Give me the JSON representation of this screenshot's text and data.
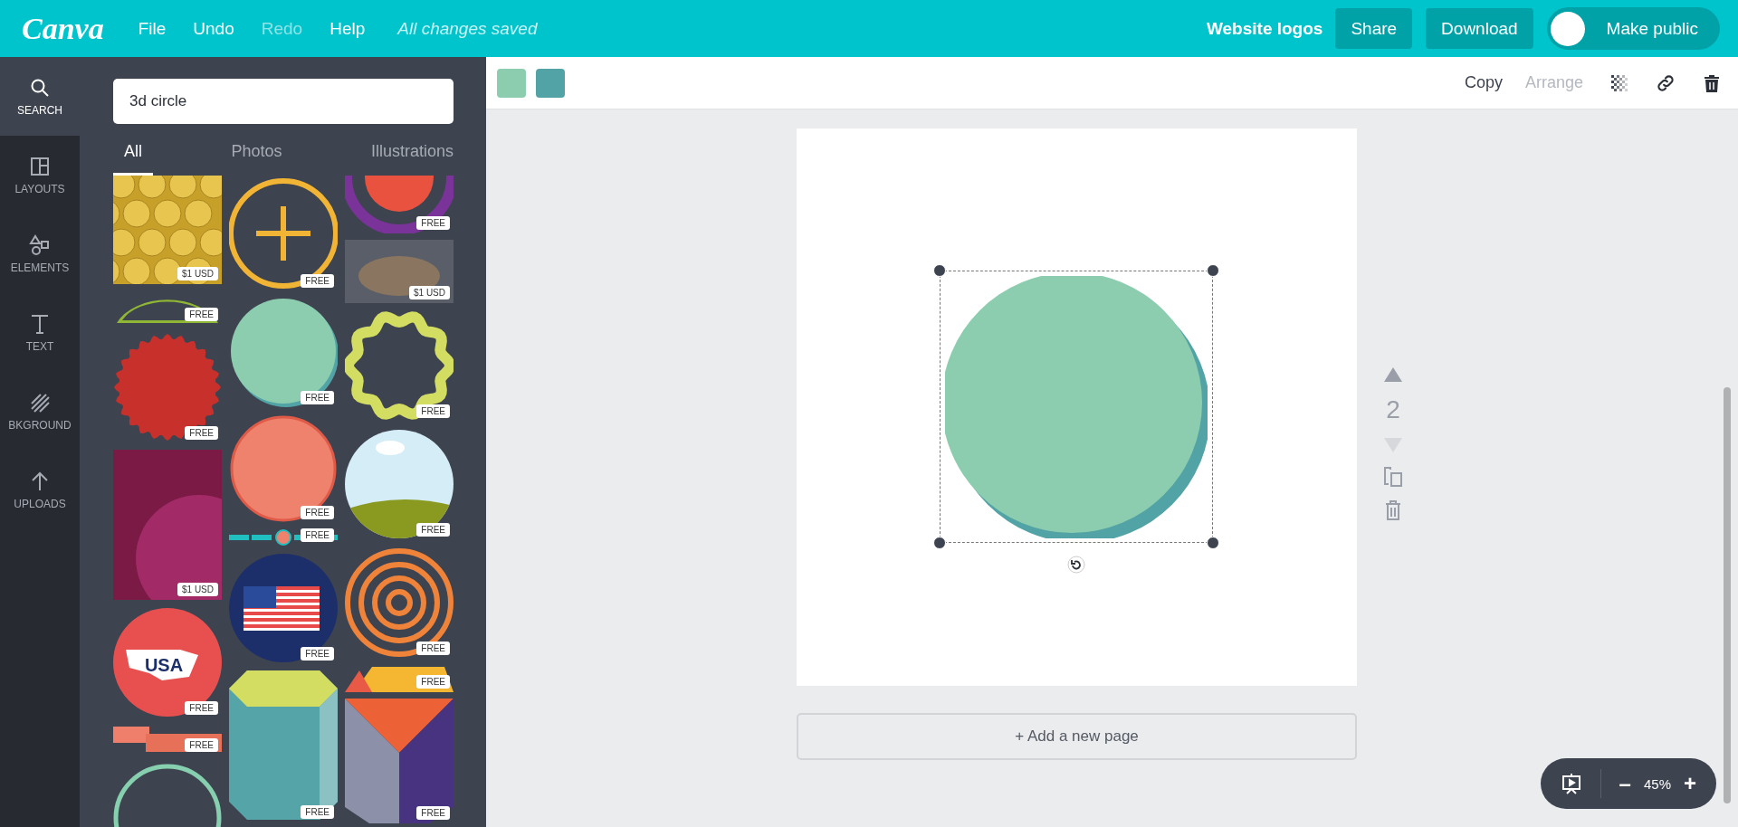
{
  "top_bar": {
    "logo": "Canva",
    "menu": [
      {
        "label": "File",
        "disabled": false
      },
      {
        "label": "Undo",
        "disabled": false
      },
      {
        "label": "Redo",
        "disabled": true
      },
      {
        "label": "Help",
        "disabled": false
      }
    ],
    "status": "All changes saved",
    "design_title": "Website logos",
    "share": "Share",
    "download": "Download",
    "make_public": {
      "label": "Make public",
      "on": false
    }
  },
  "sidebar": {
    "items": [
      {
        "kind": "search",
        "label": "SEARCH",
        "selected": true
      },
      {
        "kind": "layouts",
        "label": "LAYOUTS",
        "selected": false
      },
      {
        "kind": "elements",
        "label": "ELEMENTS",
        "selected": false
      },
      {
        "kind": "text",
        "label": "TEXT",
        "selected": false
      },
      {
        "kind": "background",
        "label": "BKGROUND",
        "selected": false
      },
      {
        "kind": "uploads",
        "label": "UPLOADS",
        "selected": false
      }
    ]
  },
  "panel": {
    "search": {
      "value": "3d circle"
    },
    "tabs": [
      {
        "label": "All",
        "selected": true
      },
      {
        "label": "Photos",
        "selected": false
      },
      {
        "label": "Illustrations",
        "selected": false
      }
    ],
    "columns": [
      [
        {
          "kind": "gold-spheres",
          "badge": "$1 USD"
        },
        {
          "kind": "arc",
          "badge": "FREE"
        },
        {
          "kind": "scallop",
          "badge": "FREE"
        },
        {
          "kind": "pink-photo",
          "badge": "$1 USD"
        },
        {
          "kind": "usa",
          "badge": "FREE",
          "caption": "USA"
        },
        {
          "kind": "ribbon",
          "badge": "FREE"
        },
        {
          "kind": "green-ring"
        }
      ],
      [
        {
          "kind": "plus-circle",
          "badge": "FREE"
        },
        {
          "kind": "teal-circle",
          "badge": "FREE"
        },
        {
          "kind": "salmon-circle",
          "badge": "FREE"
        },
        {
          "kind": "button-strip",
          "badge": "FREE"
        },
        {
          "kind": "flag-circle",
          "badge": "FREE"
        },
        {
          "kind": "hexagon",
          "badge": "FREE"
        }
      ],
      [
        {
          "kind": "target",
          "badge": "FREE"
        },
        {
          "kind": "dino-photo",
          "badge": "$1 USD"
        },
        {
          "kind": "wavy-ring",
          "badge": "FREE"
        },
        {
          "kind": "sky-circle",
          "badge": "FREE"
        },
        {
          "kind": "rings",
          "badge": "FREE"
        },
        {
          "kind": "tri-banner",
          "badge": "FREE"
        },
        {
          "kind": "prism",
          "badge": "FREE"
        }
      ]
    ]
  },
  "toolbar": {
    "colors": [
      {
        "color": "#8ccdb0"
      },
      {
        "color": "#52a3a5"
      }
    ],
    "copy": {
      "label": "Copy",
      "disabled": false
    },
    "arrange": {
      "label": "Arrange",
      "disabled": true
    }
  },
  "page_controls": {
    "page_number": "2",
    "up_disabled": false,
    "down_disabled": true
  },
  "add_page": "+ Add a new page",
  "zoom": {
    "value": "45%",
    "minus": "–",
    "plus": "+"
  }
}
